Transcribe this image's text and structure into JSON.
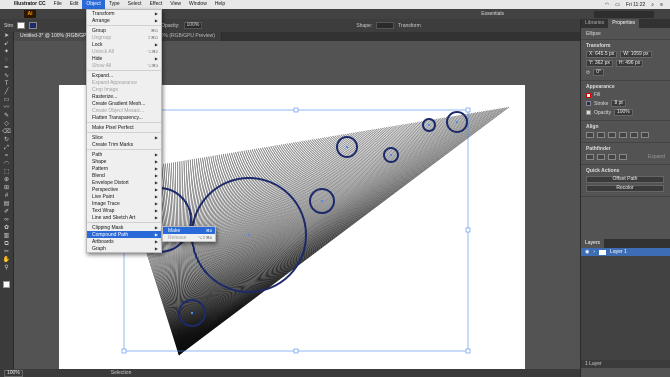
{
  "menubar": {
    "app": "Illustrator CC",
    "items": [
      "File",
      "Edit",
      "Object",
      "Type",
      "Select",
      "Effect",
      "View",
      "Window",
      "Help"
    ],
    "time": "Fri 11:22"
  },
  "appbar": {
    "logo": "Ai",
    "workspace": "Essentials"
  },
  "control": {
    "left_label": "Stro",
    "opacity_label": "Opacity:",
    "opacity_value": "100%",
    "shape_label": "Shape:",
    "transform_label": "Transform"
  },
  "tabs": [
    "Untitled-3* @ 100% (RGB/GPU Preview)",
    "Untitled-3* @ 100% (RGB/GPU Preview)"
  ],
  "tools": [
    "arrow-icon",
    "direct-select-icon",
    "wand-icon",
    "lasso-icon",
    "pen-icon",
    "curvature-icon",
    "type-icon",
    "line-icon",
    "rect-icon",
    "brush-icon",
    "pencil-icon",
    "shaper-icon",
    "eraser-icon",
    "rotate-icon",
    "scale-icon",
    "width-icon",
    "warp-icon",
    "free-transform-icon",
    "shape-builder-icon",
    "perspective-icon",
    "mesh-icon",
    "gradient-icon",
    "eyedropper-icon",
    "blend-icon",
    "symbol-icon",
    "graph-icon",
    "artboard-icon",
    "slice-icon",
    "hand-icon",
    "zoom-icon"
  ],
  "object_menu": {
    "items": [
      {
        "label": "Transform",
        "shortcut": "",
        "submenu": true,
        "disabled": false
      },
      {
        "label": "Arrange",
        "shortcut": "",
        "submenu": true,
        "disabled": false
      },
      {
        "sep": true
      },
      {
        "label": "Group",
        "shortcut": "⌘G",
        "submenu": false,
        "disabled": false
      },
      {
        "label": "Ungroup",
        "shortcut": "⇧⌘G",
        "submenu": false,
        "disabled": true
      },
      {
        "label": "Lock",
        "shortcut": "",
        "submenu": true,
        "disabled": false
      },
      {
        "label": "Unlock All",
        "shortcut": "⌥⌘2",
        "submenu": false,
        "disabled": true
      },
      {
        "label": "Hide",
        "shortcut": "",
        "submenu": true,
        "disabled": false
      },
      {
        "label": "Show All",
        "shortcut": "⌥⌘3",
        "submenu": false,
        "disabled": true
      },
      {
        "sep": true
      },
      {
        "label": "Expand...",
        "shortcut": "",
        "submenu": false,
        "disabled": false
      },
      {
        "label": "Expand Appearance",
        "shortcut": "",
        "submenu": false,
        "disabled": true
      },
      {
        "label": "Crop Image",
        "shortcut": "",
        "submenu": false,
        "disabled": true
      },
      {
        "label": "Rasterize...",
        "shortcut": "",
        "submenu": false,
        "disabled": false
      },
      {
        "label": "Create Gradient Mesh...",
        "shortcut": "",
        "submenu": false,
        "disabled": false
      },
      {
        "label": "Create Object Mosaic...",
        "shortcut": "",
        "submenu": false,
        "disabled": true
      },
      {
        "label": "Flatten Transparency...",
        "shortcut": "",
        "submenu": false,
        "disabled": false
      },
      {
        "sep": true
      },
      {
        "label": "Make Pixel Perfect",
        "shortcut": "",
        "submenu": false,
        "disabled": false
      },
      {
        "sep": true
      },
      {
        "label": "Slice",
        "shortcut": "",
        "submenu": true,
        "disabled": false
      },
      {
        "label": "Create Trim Marks",
        "shortcut": "",
        "submenu": false,
        "disabled": false
      },
      {
        "sep": true
      },
      {
        "label": "Path",
        "shortcut": "",
        "submenu": true,
        "disabled": false
      },
      {
        "label": "Shape",
        "shortcut": "",
        "submenu": true,
        "disabled": false
      },
      {
        "label": "Pattern",
        "shortcut": "",
        "submenu": true,
        "disabled": false
      },
      {
        "label": "Blend",
        "shortcut": "",
        "submenu": true,
        "disabled": false
      },
      {
        "label": "Envelope Distort",
        "shortcut": "",
        "submenu": true,
        "disabled": false
      },
      {
        "label": "Perspective",
        "shortcut": "",
        "submenu": true,
        "disabled": false
      },
      {
        "label": "Live Paint",
        "shortcut": "",
        "submenu": true,
        "disabled": false
      },
      {
        "label": "Image Trace",
        "shortcut": "",
        "submenu": true,
        "disabled": false
      },
      {
        "label": "Text Wrap",
        "shortcut": "",
        "submenu": true,
        "disabled": false
      },
      {
        "label": "Line and Sketch Art",
        "shortcut": "",
        "submenu": true,
        "disabled": false
      },
      {
        "sep": true
      },
      {
        "label": "Clipping Mask",
        "shortcut": "",
        "submenu": true,
        "disabled": false
      },
      {
        "label": "Compound Path",
        "shortcut": "",
        "submenu": true,
        "disabled": false,
        "highlighted": true
      },
      {
        "label": "Artboards",
        "shortcut": "",
        "submenu": true,
        "disabled": false
      },
      {
        "label": "Graph",
        "shortcut": "",
        "submenu": true,
        "disabled": false
      }
    ]
  },
  "compound_submenu": {
    "items": [
      {
        "label": "Make",
        "shortcut": "⌘8",
        "disabled": false,
        "highlighted": true
      },
      {
        "label": "Release",
        "shortcut": "⌥⇧⌘8",
        "disabled": true
      }
    ]
  },
  "panel": {
    "tabs": [
      "Libraries",
      "Properties"
    ],
    "selection": "Ellipse",
    "transform_title": "Transform",
    "x": "X: 645.5 px",
    "w": "W: 1059 px",
    "y": "Y: 362 px",
    "h": "H: 496 px",
    "rotate": "0°",
    "appearance_title": "Appearance",
    "fill": "Fill",
    "stroke": "Stroke",
    "stroke_value": "8 pt",
    "opacity": "Opacity",
    "opacity_value": "100%",
    "align_title": "Align",
    "pathfinder_title": "Pathfinder",
    "expand": "Expand",
    "quick_actions_title": "Quick Actions",
    "qa_button_1": "Offset Path",
    "qa_button_2": "Recolor"
  },
  "layers": {
    "tabs": [
      "Layers"
    ],
    "layer_name": "Layer 1",
    "footer": "1 Layer"
  },
  "status": {
    "zoom": "100%",
    "tool": "Selection"
  },
  "colors": {
    "accent": "#2a6ad8",
    "circle_stroke": "#1c2a6b"
  }
}
